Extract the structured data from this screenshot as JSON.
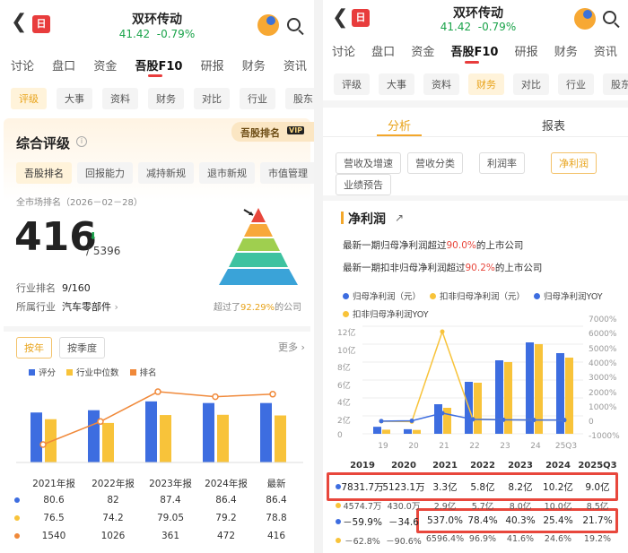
{
  "header": {
    "back_icon": "chevron-left-icon",
    "logo_text": "日",
    "stock_name": "双环传动",
    "price": "41.42",
    "change": "-0.79%",
    "colors": {
      "up": "#e83c3c",
      "down": "#1aa34a",
      "accent": "#f3a72b"
    }
  },
  "main_tabs": [
    "讨论",
    "盘口",
    "资金",
    "吾股F10",
    "研报",
    "财务",
    "资讯"
  ],
  "left": {
    "sub_tabs": [
      "评级",
      "大事",
      "资料",
      "财务",
      "对比",
      "行业",
      "股东"
    ],
    "card_title": "综合评级",
    "rank_badge": "吾股排名",
    "vip": "VIP",
    "rating_tabs": [
      "吾股排名",
      "回报能力",
      "减持新规",
      "退市新规",
      "市值管理"
    ],
    "market_rank_label": "全市场排名（2026－02－28）",
    "rank": "416",
    "rank_total": "5396",
    "industry_rank_label": "行业排名",
    "industry_rank": "9/160",
    "industry_label": "所属行业",
    "industry": "汽车零部件",
    "beat_prefix": "超过了",
    "beat_pct": "92.29%",
    "beat_suffix": "的公司",
    "period_tabs": [
      "按年",
      "按季度"
    ],
    "more": "更多",
    "legend": [
      "评分",
      "行业中位数",
      "排名"
    ],
    "chart_data": {
      "type": "bar",
      "categories": [
        "2021年报",
        "2022年报",
        "2023年报",
        "2024年报",
        "最新"
      ],
      "series": [
        {
          "name": "评分",
          "type": "bar",
          "values": [
            80.6,
            82,
            87.4,
            86.4,
            86.4
          ],
          "color": "#3d6de0"
        },
        {
          "name": "行业中位数",
          "type": "bar",
          "values": [
            76.5,
            74.2,
            79.05,
            79.2,
            78.8
          ],
          "color": "#f8c33a"
        },
        {
          "name": "排名",
          "type": "line",
          "values": [
            1540,
            1026,
            361,
            472,
            416
          ],
          "color": "#f0893a"
        }
      ]
    },
    "table_rows": [
      [
        "80.6",
        "82",
        "87.4",
        "86.4",
        "86.4"
      ],
      [
        "76.5",
        "74.2",
        "79.05",
        "79.2",
        "78.8"
      ],
      [
        "1540",
        "1026",
        "361",
        "472",
        "416"
      ]
    ]
  },
  "right": {
    "sub_tabs": [
      "评级",
      "大事",
      "资料",
      "财务",
      "对比",
      "行业",
      "股东"
    ],
    "view_tabs": [
      "分析",
      "报表"
    ],
    "filters": [
      "营收及增速",
      "营收分类",
      "利润率",
      "净利润",
      "业绩预告"
    ],
    "section_title": "净利润",
    "line1_prefix": "最新一期归母净利润超过",
    "line1_pct": "90.0%",
    "line1_suffix": "的上市公司",
    "line2_prefix": "最新一期扣非归母净利润超过",
    "line2_pct": "90.2%",
    "line2_suffix": "的上市公司",
    "legend": [
      "归母净利润（元）",
      "扣非归母净利润（元）",
      "归母净利润YOY",
      "扣非归母净利润YOY"
    ],
    "y_left": [
      "12亿",
      "10亿",
      "8亿",
      "6亿",
      "4亿",
      "2亿",
      "0"
    ],
    "y_right": [
      "7000%",
      "6000%",
      "5000%",
      "4000%",
      "3000%",
      "2000%",
      "1000%",
      "0",
      "-1000%"
    ],
    "x_labels": [
      "19",
      "20",
      "21",
      "22",
      "23",
      "24",
      "25Q3"
    ],
    "chart_data": {
      "type": "bar",
      "categories": [
        "2019",
        "2020",
        "2021",
        "2022",
        "2023",
        "2024",
        "2025Q3"
      ],
      "ylim": [
        0,
        1200000000
      ],
      "y2lim": [
        -1000,
        7000
      ],
      "series": [
        {
          "name": "归母净利润（元）",
          "type": "bar",
          "values": [
            78317000,
            51231000,
            330000000,
            580000000,
            820000000,
            1020000000,
            900000000
          ],
          "color": "#3d6de0"
        },
        {
          "name": "扣非归母净利润（元）",
          "type": "bar",
          "values": [
            45747000,
            43000000,
            290000000,
            570000000,
            800000000,
            1000000000,
            850000000
          ],
          "color": "#f8c33a"
        },
        {
          "name": "归母净利润YOY",
          "type": "line",
          "values": [
            -59.9,
            -34.6,
            537.0,
            78.4,
            40.3,
            25.4,
            21.7
          ],
          "color": "#3d6de0"
        },
        {
          "name": "扣非归母净利润YOY",
          "type": "line",
          "values": [
            -62.8,
            -90.6,
            6596.4,
            96.9,
            41.6,
            24.6,
            19.2
          ],
          "color": "#f8c33a"
        }
      ]
    },
    "table_head": [
      "2019",
      "2020",
      "2021",
      "2022",
      "2023",
      "2024",
      "2025Q3"
    ],
    "table_rows": [
      [
        "7831.7万",
        "5123.1万",
        "3.3亿",
        "5.8亿",
        "8.2亿",
        "10.2亿",
        "9.0亿"
      ],
      [
        "4574.7万",
        "430.0万",
        "2.9亿",
        "5.7亿",
        "8.0亿",
        "10.0亿",
        "8.5亿"
      ],
      [
        "－59.9%",
        "－34.6",
        "537.0%",
        "78.4%",
        "40.3%",
        "25.4%",
        "21.7%"
      ],
      [
        "－62.8%",
        "－90.6%",
        "6596.4%",
        "96.9%",
        "41.6%",
        "24.6%",
        "19.2%"
      ]
    ]
  }
}
